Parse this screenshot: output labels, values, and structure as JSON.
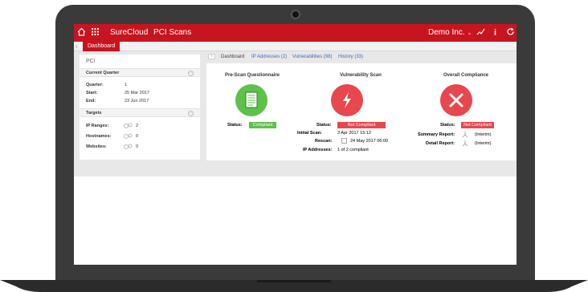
{
  "header": {
    "brand": "SureCloud",
    "module": "PCI Scans",
    "company": "Demo Inc."
  },
  "tabs": {
    "active_tab": "Dashboard"
  },
  "left_panel": {
    "title": "PCI",
    "current_quarter": {
      "heading": "Current Quarter",
      "rows": [
        {
          "label": "Quarter:",
          "value": "1"
        },
        {
          "label": "Start:",
          "value": "25 Mar 2017"
        },
        {
          "label": "End:",
          "value": "23 Jun 2017"
        }
      ]
    },
    "targets": {
      "heading": "Targets",
      "rows": [
        {
          "label": "IP Ranges:",
          "value": "2"
        },
        {
          "label": "Hostnames:",
          "value": "0"
        },
        {
          "label": "Websites:",
          "value": "0"
        }
      ]
    }
  },
  "right_tabs": [
    {
      "label": "Dashboard"
    },
    {
      "label": "IP Addresses (2)"
    },
    {
      "label": "Vulnerabilities (98)"
    },
    {
      "label": "History (33)"
    }
  ],
  "columns": {
    "questionnaire": {
      "title": "Pre-Scan Questionnaire",
      "status_label": "Status:",
      "status_value": "Compliant",
      "color": "#5dc24a"
    },
    "vulnerability": {
      "title": "Vulnerability Scan",
      "status_label": "Status:",
      "status_value": "Not Compliant",
      "initial_label": "Initial Scan:",
      "initial_value": "3 Apr 2017 15:12",
      "rescan_label": "Rescan:",
      "rescan_value": "24 May 2017 06:00",
      "ip_label": "IP Addresses:",
      "ip_value": "1 of 2 compliant",
      "color": "#e8474d"
    },
    "overall": {
      "title": "Overall Compliance",
      "status_label": "Status:",
      "status_value": "Not Compliant",
      "summary_label": "Summary Report:",
      "summary_value": "(Interim)",
      "detail_label": "Detail Report:",
      "detail_value": "(Interim)",
      "color": "#e8474d"
    }
  },
  "icons": {
    "home": "home-icon",
    "apps": "grid-icon",
    "theme": "brand-red"
  }
}
